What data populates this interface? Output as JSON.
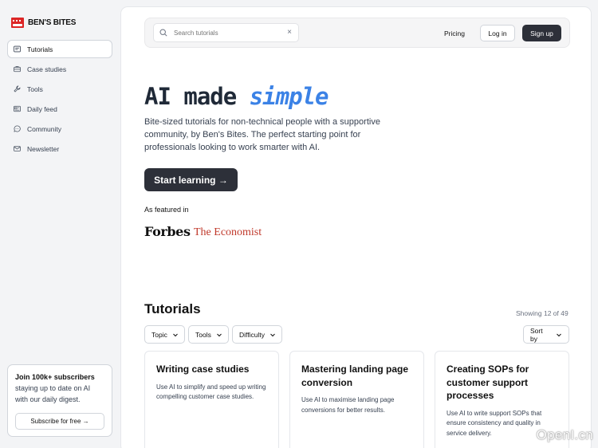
{
  "brand": {
    "name": "BEN'S BITES",
    "accent": "#dc2626"
  },
  "sidebar": {
    "items": [
      {
        "label": "Tutorials",
        "icon": "tutorial-icon",
        "active": true
      },
      {
        "label": "Case studies",
        "icon": "briefcase-icon",
        "active": false
      },
      {
        "label": "Tools",
        "icon": "wrench-icon",
        "active": false
      },
      {
        "label": "Daily feed",
        "icon": "feed-icon",
        "active": false
      },
      {
        "label": "Community",
        "icon": "chat-icon",
        "active": false
      },
      {
        "label": "Newsletter",
        "icon": "mail-icon",
        "active": false
      }
    ],
    "subscribe": {
      "title": "Join 100k+ subscribers",
      "text": "staying up to date on AI with our daily digest.",
      "button": "Subscribe for free →"
    }
  },
  "header": {
    "search_placeholder": "Search tutorials",
    "search_clear": "×",
    "pricing": "Pricing",
    "login": "Log in",
    "signup": "Sign up"
  },
  "hero": {
    "title_prefix": "AI made ",
    "title_accent": "simple",
    "description": "Bite-sized tutorials for non-technical people with a supportive community, by Ben's Bites. The perfect starting point for professionals looking to work smarter with AI.",
    "cta": "Start learning →",
    "featured_label": "As featured in",
    "featured": [
      "Forbes",
      "The Economist"
    ],
    "accent_color": "#3b82e6"
  },
  "tutorials": {
    "heading": "Tutorials",
    "showing": "Showing 12 of 49",
    "filters": [
      "Topic",
      "Tools",
      "Difficulty"
    ],
    "sort": "Sort by",
    "cards": [
      {
        "title": "Writing case studies",
        "description": "Use AI to simplify and speed up writing compelling customer case studies."
      },
      {
        "title": "Mastering landing page conversion",
        "description": "Use AI to maximise landing page conversions for better results."
      },
      {
        "title": "Creating SOPs for customer support processes",
        "description": "Use AI to write support SOPs that ensure consistency and quality in service delivery."
      }
    ]
  },
  "watermark": "OpenI.cn"
}
